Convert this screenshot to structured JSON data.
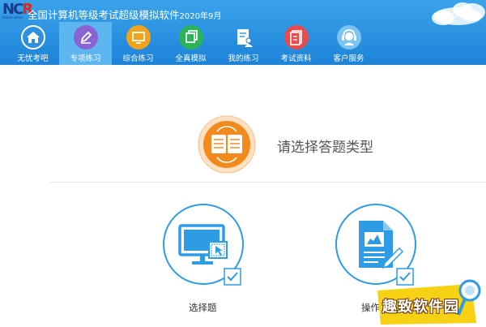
{
  "header": {
    "logo_text_a": "NC",
    "logo_text_b": "R",
    "logo_sub": "Examination",
    "title": "全国计算机等级考试超级模拟软件",
    "version": "2020年9月"
  },
  "nav": [
    {
      "label": "无忧考吧",
      "icon": "home-icon",
      "color": "#2f8fe0"
    },
    {
      "label": "专项练习",
      "icon": "pencil-icon",
      "color": "#8a63d2",
      "active": true
    },
    {
      "label": "综合练习",
      "icon": "monitor-icon",
      "color": "#f3a21c"
    },
    {
      "label": "全真模拟",
      "icon": "copy-icon",
      "color": "#2bb35a"
    },
    {
      "label": "我的练习",
      "icon": "user-doc-icon",
      "color": "#ffffff"
    },
    {
      "label": "考试资料",
      "icon": "document-icon",
      "color": "#e94b4b"
    },
    {
      "label": "客户服务",
      "icon": "headset-icon",
      "color": "#5ab0e8"
    }
  ],
  "main": {
    "prompt": "请选择答题类型",
    "types": [
      {
        "label": "选择题",
        "icon": "computer-icon"
      },
      {
        "label": "操作题",
        "icon": "report-chart-icon"
      }
    ]
  },
  "watermark": {
    "text": "趣致软件园"
  },
  "colors": {
    "header_top": "#3aa3ea",
    "header_bottom": "#1d83d8",
    "accent_blue": "#2e9be5",
    "accent_orange": "#f28a1d"
  }
}
